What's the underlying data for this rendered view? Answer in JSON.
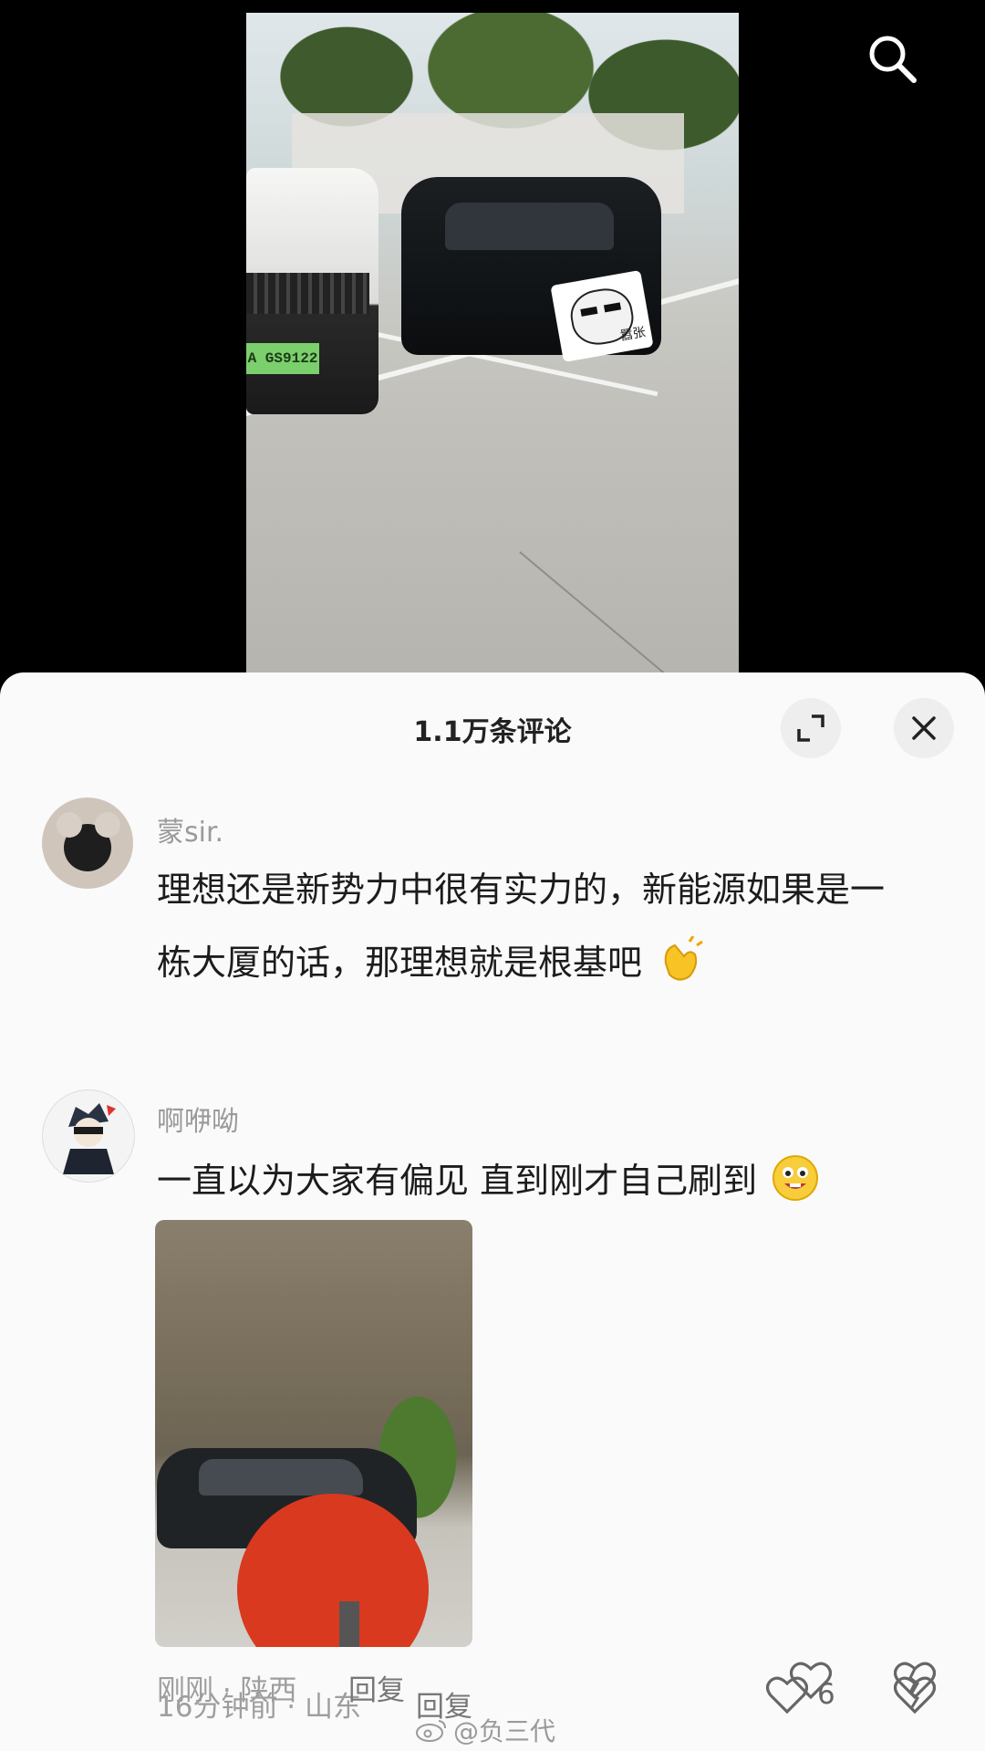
{
  "video": {
    "plate_text": "A GS9122",
    "sticker_text": "嚣张",
    "search_icon": "search-icon"
  },
  "comments_sheet": {
    "title": "1.1万条评论",
    "expand_icon": "expand-icon",
    "close_icon": "close-icon"
  },
  "comments": [
    {
      "username": "蒙sir.",
      "text_line1": "理想还是新势力中很有实力的，新能源如果是一",
      "text_line2": "栋大厦的话，那理想就是根基吧",
      "emoji": "clapping-hands-emoji",
      "meta": "16分钟前 · 山东",
      "reply_label": "回复",
      "like_count": "6"
    },
    {
      "username": "啊咿呦",
      "text": "一直以为大家有偏见 直到刚才自己刷到",
      "emoji": "grinning-face-emoji",
      "meta": "刚刚 · 陕西",
      "reply_label": "回复",
      "like_count": ""
    }
  ],
  "watermark": "@负三代",
  "colors": {
    "sheet_bg": "#fafafa",
    "text_primary": "#1c1c1c",
    "text_secondary": "#9a9a9a"
  }
}
